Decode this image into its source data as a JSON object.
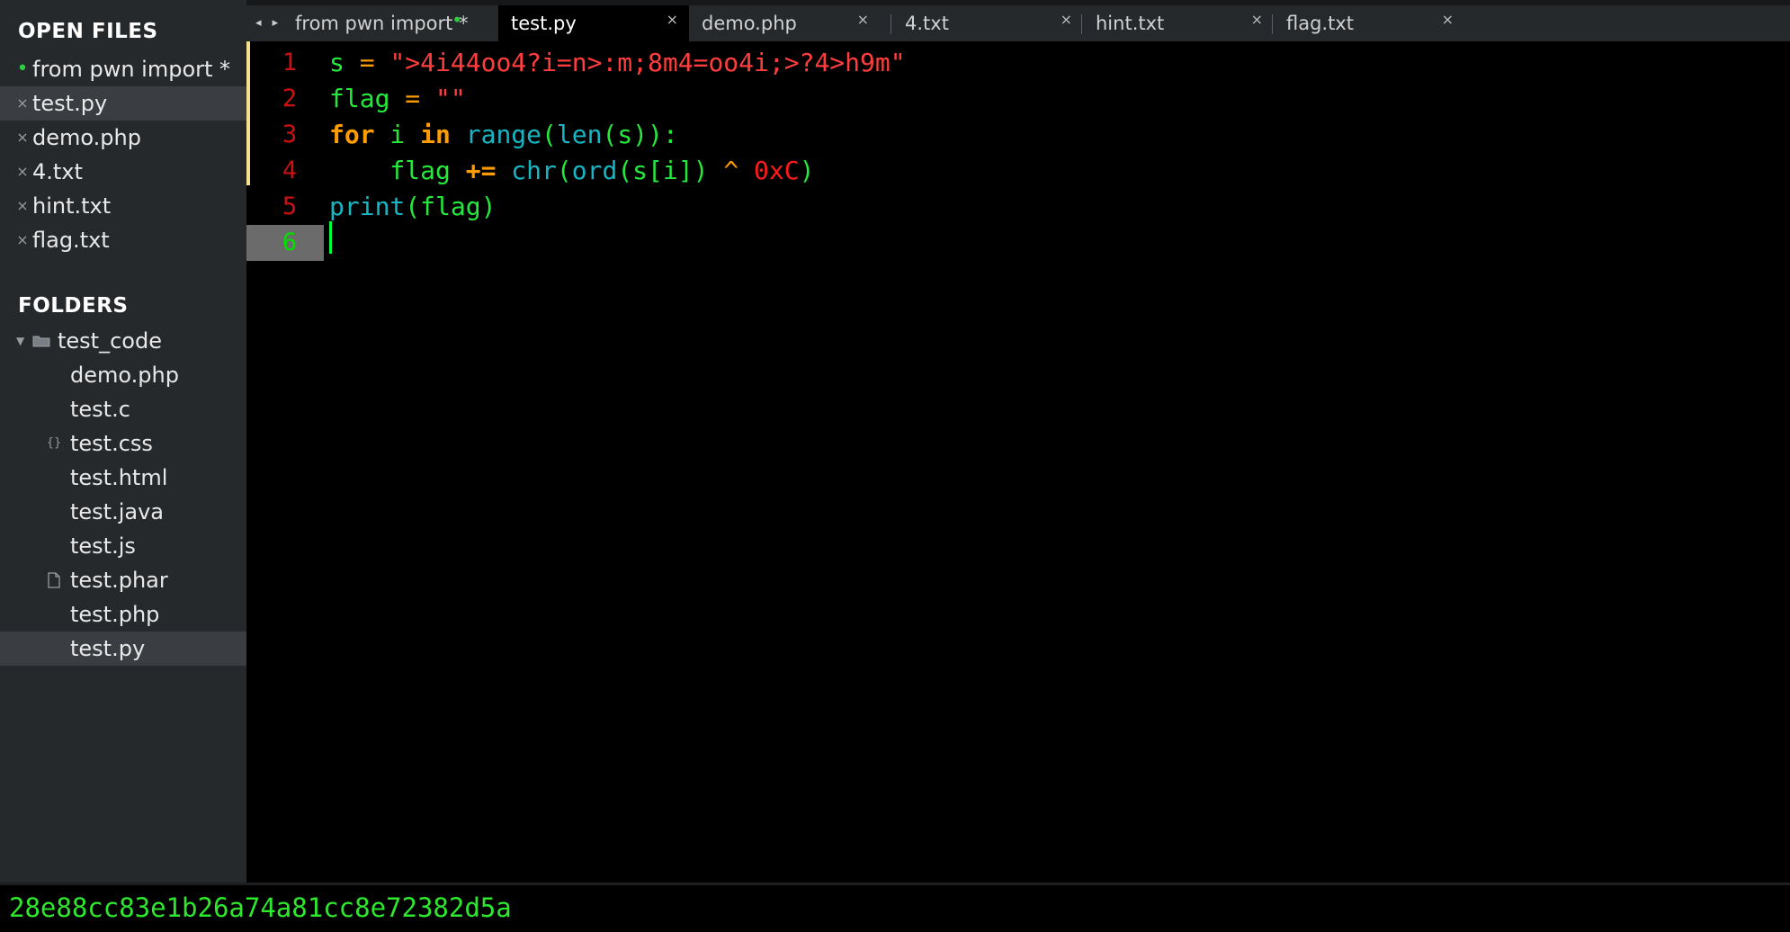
{
  "sidebar": {
    "open_files_heading": "OPEN FILES",
    "open_files": [
      {
        "label": "from pwn import *",
        "marker": "•"
      },
      {
        "label": "test.py",
        "marker": "×"
      },
      {
        "label": "demo.php",
        "marker": "×"
      },
      {
        "label": "4.txt",
        "marker": "×"
      },
      {
        "label": "hint.txt",
        "marker": "×"
      },
      {
        "label": "flag.txt",
        "marker": "×"
      }
    ],
    "folders_heading": "FOLDERS",
    "folder": {
      "label": "test_code"
    },
    "files": [
      {
        "label": "demo.php",
        "icon": ""
      },
      {
        "label": "test.c",
        "icon": ""
      },
      {
        "label": "test.css",
        "icon": "{}"
      },
      {
        "label": "test.html",
        "icon": ""
      },
      {
        "label": "test.java",
        "icon": ""
      },
      {
        "label": "test.js",
        "icon": ""
      },
      {
        "label": "test.phar",
        "icon": "file-icon"
      },
      {
        "label": "test.php",
        "icon": ""
      },
      {
        "label": "test.py",
        "icon": ""
      }
    ]
  },
  "tabs": [
    {
      "label": "from pwn import *",
      "indicator": "•"
    },
    {
      "label": "test.py",
      "indicator": "×"
    },
    {
      "label": "demo.php",
      "indicator": "×"
    },
    {
      "label": "4.txt",
      "indicator": "×"
    },
    {
      "label": "hint.txt",
      "indicator": "×"
    },
    {
      "label": "flag.txt",
      "indicator": "×"
    }
  ],
  "tab_nav": "◂ ▸",
  "editor": {
    "line_numbers": [
      "1",
      "2",
      "3",
      "4",
      "5",
      "6"
    ],
    "lines": [
      [
        {
          "t": "s",
          "c": "var"
        },
        {
          "t": " = ",
          "c": "op"
        },
        {
          "t": "\">4i44oo4?i=n>:m;8m4=oo4i;>?4>h9m\"",
          "c": "str"
        }
      ],
      [
        {
          "t": "flag",
          "c": "var"
        },
        {
          "t": " = ",
          "c": "op"
        },
        {
          "t": "\"\"",
          "c": "str"
        }
      ],
      [
        {
          "t": "for",
          "c": "kw"
        },
        {
          "t": " i ",
          "c": "var"
        },
        {
          "t": "in",
          "c": "kw"
        },
        {
          "t": " ",
          "c": "plain"
        },
        {
          "t": "range",
          "c": "fn"
        },
        {
          "t": "(",
          "c": "plain"
        },
        {
          "t": "len",
          "c": "fn"
        },
        {
          "t": "(s)):",
          "c": "plain"
        }
      ],
      [
        {
          "t": "    flag ",
          "c": "var"
        },
        {
          "t": "+=",
          "c": "kw"
        },
        {
          "t": " ",
          "c": "plain"
        },
        {
          "t": "chr",
          "c": "fn"
        },
        {
          "t": "(",
          "c": "plain"
        },
        {
          "t": "ord",
          "c": "fn"
        },
        {
          "t": "(s[i]) ",
          "c": "plain"
        },
        {
          "t": "^",
          "c": "op"
        },
        {
          "t": " ",
          "c": "plain"
        },
        {
          "t": "0xC",
          "c": "num"
        },
        {
          "t": ")",
          "c": "plain"
        }
      ],
      [
        {
          "t": "print",
          "c": "fn"
        },
        {
          "t": "(flag)",
          "c": "plain"
        }
      ],
      []
    ]
  },
  "output": {
    "text": "28e88cc83e1b26a74a81cc8e72382d5a"
  },
  "colors": {
    "sidebar_bg": "#26292c",
    "editor_bg": "#000000",
    "string": "#ff3d3d",
    "keyword": "#ff9d00",
    "function": "#16b6c3",
    "identifier": "#24e83c",
    "line_number": "#cc1111",
    "modified_dot": "#2ecc40"
  }
}
